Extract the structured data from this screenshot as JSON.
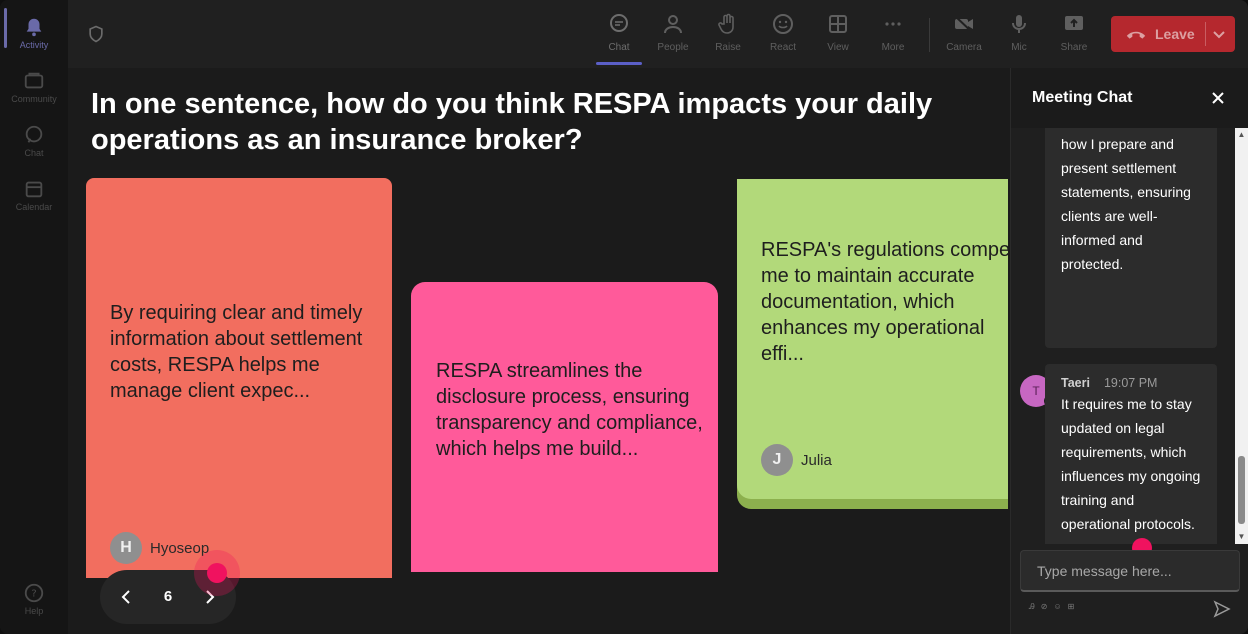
{
  "rail": {
    "items": [
      {
        "label": "Activity",
        "icon": "bell-icon"
      },
      {
        "label": "Community",
        "icon": "community-icon"
      },
      {
        "label": "Chat",
        "icon": "chat-icon"
      },
      {
        "label": "Calendar",
        "icon": "calendar-icon"
      }
    ],
    "help_label": "Help"
  },
  "toolbar": {
    "buttons": [
      {
        "label": "Chat",
        "icon": "chat-icon"
      },
      {
        "label": "People",
        "icon": "people-icon"
      },
      {
        "label": "Raise",
        "icon": "hand-icon"
      },
      {
        "label": "React",
        "icon": "smile-icon"
      },
      {
        "label": "View",
        "icon": "grid-icon"
      },
      {
        "label": "More",
        "icon": "more-icon"
      },
      {
        "label": "Camera",
        "icon": "camera-off-icon"
      },
      {
        "label": "Mic",
        "icon": "mic-icon"
      },
      {
        "label": "Share",
        "icon": "share-icon"
      }
    ],
    "leave_label": "Leave",
    "leave_color": "#b5282e"
  },
  "stage": {
    "question": "In one sentence, how do you think RESPA impacts your daily operations as an insurance broker?",
    "cards": [
      {
        "text": "By requiring clear and timely information about settlement costs, RESPA helps me manage client expec...",
        "author": "Hyoseop",
        "initial": "H",
        "color": "#f26e5f"
      },
      {
        "text": "RESPA streamlines the disclosure process, ensuring transparency and compliance, which helps me build...",
        "author": "",
        "initial": "",
        "color": "#ff5a9a"
      },
      {
        "text": "RESPA's regulations compel me to maintain accurate documentation, which enhances my operational effi...",
        "author": "Julia",
        "initial": "J",
        "color": "#b2d97a"
      }
    ],
    "page_number": "6"
  },
  "chat": {
    "title": "Meeting Chat",
    "messages": [
      {
        "name": "",
        "time": "",
        "text": "how I prepare and present settlement statements, ensuring clients are well-informed and protected."
      },
      {
        "name": "Taeri",
        "time": "19:07 PM",
        "initial": "T",
        "text": "It requires me to stay updated on legal requirements, which influences my ongoing training and operational protocols."
      }
    ],
    "input_placeholder": "Type message here...",
    "accent": "#c767c2"
  }
}
